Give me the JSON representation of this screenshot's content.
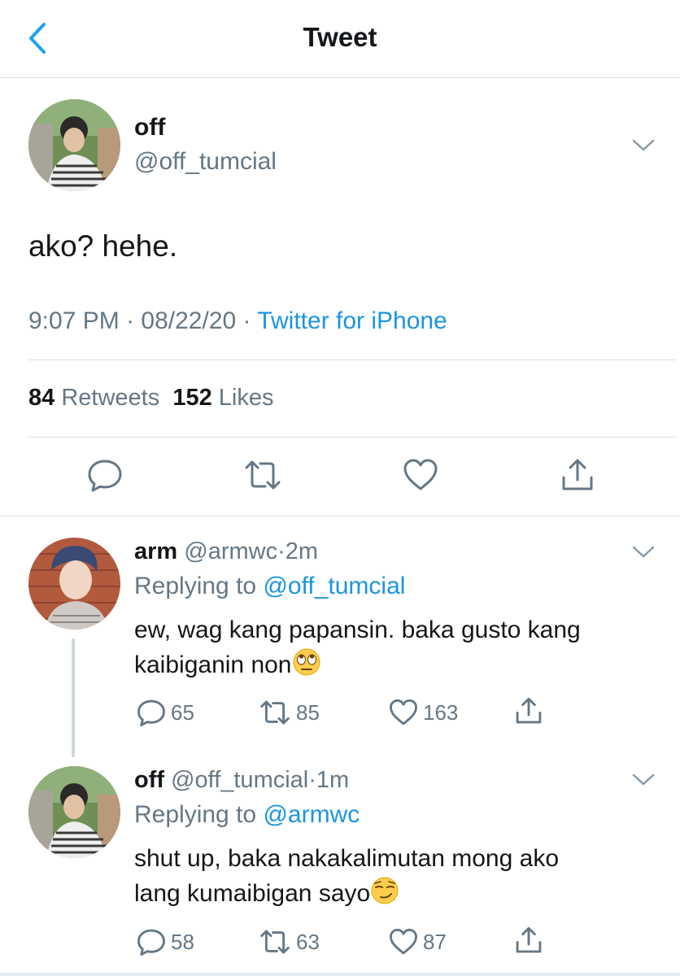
{
  "header": {
    "title": "Tweet",
    "back_icon": "chevron-left-icon"
  },
  "colors": {
    "link": "#1b95e0",
    "muted": "#657786",
    "text": "#14171a",
    "divider": "#d8dde2"
  },
  "tweet": {
    "display_name": "off",
    "handle": "@off_tumcial",
    "text": "ako? hehe.",
    "time": "9:07 PM",
    "date": "08/22/20",
    "dot": "·",
    "source": "Twitter for iPhone",
    "retweets_count": "84",
    "retweets_label": "Retweets",
    "likes_count": "152",
    "likes_label": "Likes",
    "actions": [
      "reply-icon",
      "retweet-icon",
      "like-icon",
      "share-icon"
    ]
  },
  "replies": [
    {
      "display_name": "arm",
      "handle": "@armwc",
      "dot": "·",
      "time": "2m",
      "replying_prefix": "Replying to",
      "replying_to": "@off_tumcial",
      "text_line1": "ew, wag kang papansin. baka gusto kang",
      "text_line2": "kaibiganin non",
      "emoji": "rolling-eyes-emoji",
      "reply_count": "65",
      "retweet_count": "85",
      "like_count": "163"
    },
    {
      "display_name": "off",
      "handle": "@off_tumcial",
      "dot": "·",
      "time": "1m",
      "replying_prefix": "Replying to",
      "replying_to": "@armwc",
      "text_line1": "shut up, baka nakakalimutan mong ako",
      "text_line2": "lang kumaibigan sayo",
      "emoji": "smirking-face-emoji",
      "reply_count": "58",
      "retweet_count": "63",
      "like_count": "87"
    }
  ]
}
